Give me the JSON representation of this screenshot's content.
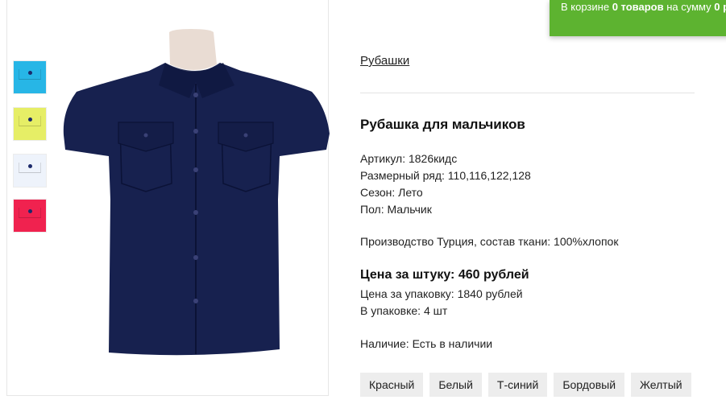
{
  "cart": {
    "prefix": "В корзине",
    "count": "0 товаров",
    "middle": "на сумму",
    "sum": "0 р"
  },
  "gallery": {
    "thumbnails": [
      {
        "name": "голубой",
        "color": "#27b6e6"
      },
      {
        "name": "желтый",
        "color": "#e6ee66"
      },
      {
        "name": "белый",
        "color": "#eef3fb"
      },
      {
        "name": "красный",
        "color": "#f0224f"
      }
    ],
    "main_color": "#17214f"
  },
  "breadcrumb": "Рубашки",
  "product": {
    "title": "Рубашка для мальчиков",
    "article": "Артикул: 1826кидс",
    "sizes": "Размерный ряд: 110,116,122,128",
    "season": "Сезон: Лето",
    "gender": "Пол: Мальчик",
    "production": "Производство Турция, состав ткани: 100%хлопок",
    "price_unit": "Цена за штуку: 460 рублей",
    "price_pack": "Цена за упаковку: 1840 рублей",
    "pack_size": "В упаковке: 4 шт",
    "availability": "Наличие: Есть в наличии"
  },
  "colors": [
    "Красный",
    "Белый",
    "Т-синий",
    "Бордовый",
    "Желтый"
  ],
  "accent": "#5db330"
}
